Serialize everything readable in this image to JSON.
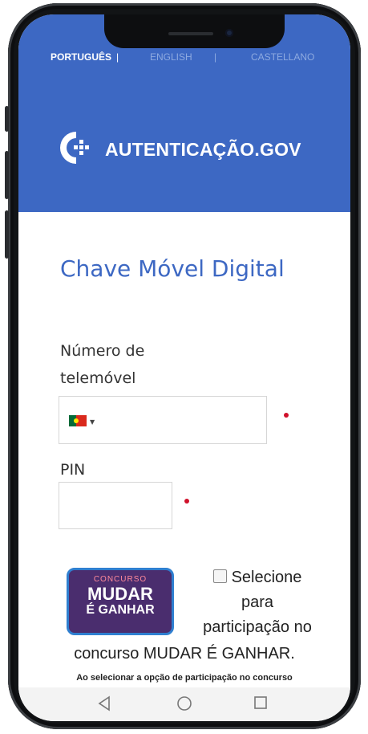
{
  "header": {
    "languages": [
      {
        "label": "PORTUGUÊS",
        "active": true
      },
      {
        "label": "ENGLISH",
        "active": false
      },
      {
        "label": "CASTELLANO",
        "active": false
      }
    ],
    "brand": "AUTENTICAÇÃO.GOV",
    "color": "#3d68c3"
  },
  "form": {
    "title": "Chave Móvel Digital",
    "phone_label_line1": "Número de",
    "phone_label_line2": "telemóvel",
    "phone_value": "",
    "country_flag": "portugal-flag",
    "pin_label": "PIN",
    "pin_value": ""
  },
  "contest": {
    "badge_top": "CONCURSO",
    "badge_line1": "MUDAR",
    "badge_line2": "É GANHAR",
    "checkbox_label_line1": "Selecione",
    "checkbox_label_line2": "para",
    "checkbox_label_line3": "participação no",
    "concurso_line": "concurso MUDAR É GANHAR.",
    "note": "Ao selecionar a opção de participação no concurso"
  },
  "navigation": {
    "back_icon": "triangle-back-icon",
    "home_icon": "circle-home-icon",
    "recent_icon": "square-recents-icon"
  }
}
